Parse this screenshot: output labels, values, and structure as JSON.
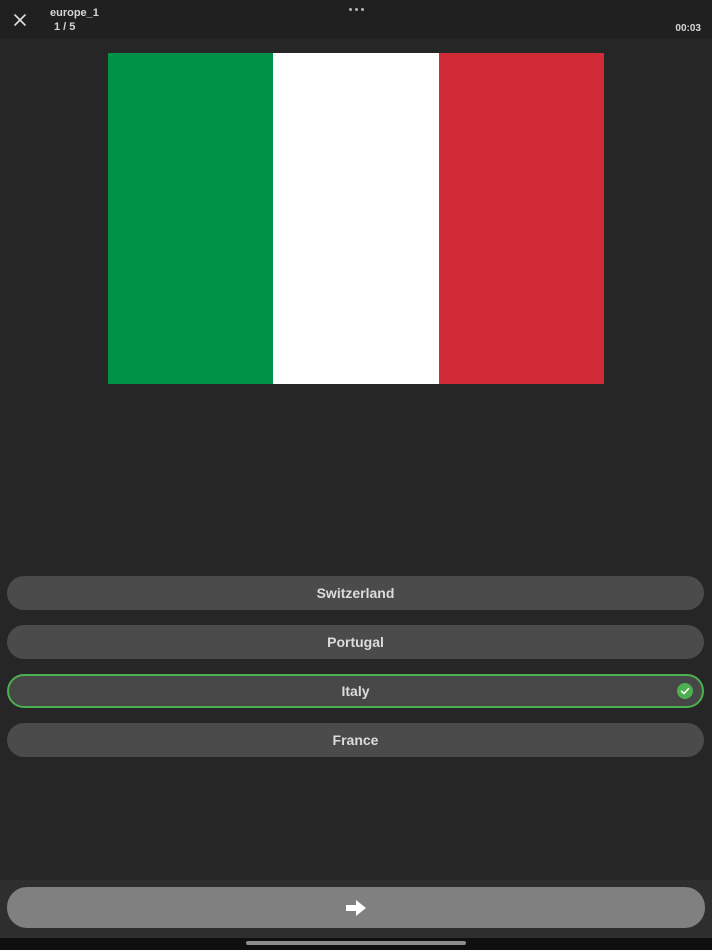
{
  "header": {
    "quiz_name": "europe_1",
    "progress": "1 / 5",
    "timer": "00:03",
    "close_icon": "close-icon",
    "more_icon": "more-horizontal-icon"
  },
  "question": {
    "flag_colors": [
      "#009246",
      "#ffffff",
      "#d12b37"
    ]
  },
  "answers": [
    {
      "label": "Switzerland",
      "selected": false
    },
    {
      "label": "Portugal",
      "selected": false
    },
    {
      "label": "Italy",
      "selected": true
    },
    {
      "label": "France",
      "selected": false
    }
  ],
  "footer": {
    "next_icon": "arrow-right-icon"
  },
  "colors": {
    "background": "#262626",
    "answer_bg": "#4b4b4b",
    "selected_border": "#4caf50",
    "next_button": "#808080"
  }
}
